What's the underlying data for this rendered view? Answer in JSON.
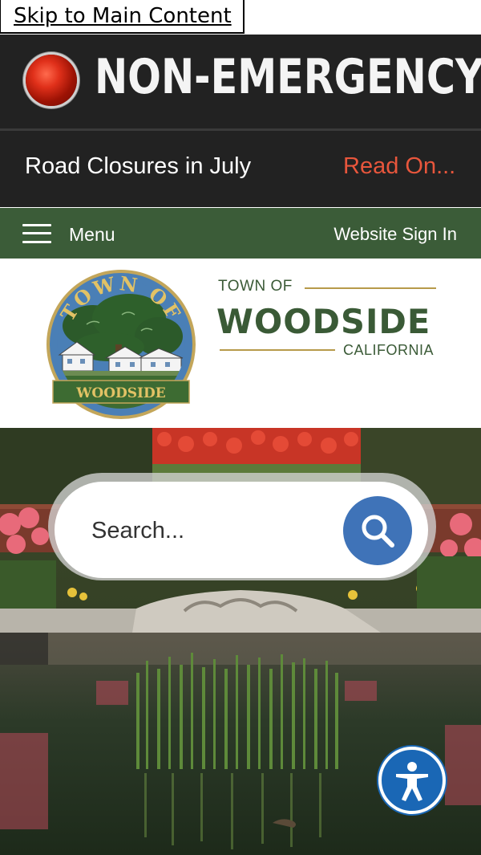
{
  "skip_link": {
    "label": "Skip to Main Content"
  },
  "emergency_banner": {
    "text": "NON-EMERGENCY A",
    "light_color": "#d8301a",
    "icon": "alert-light-icon"
  },
  "alert_ticker": {
    "title": "Road Closures in July",
    "link_label": "Read On...",
    "link_color": "#e8563c"
  },
  "nav": {
    "menu_label": "Menu",
    "sign_in_label": "Website Sign In",
    "bar_color": "#3b5c38",
    "icon": "hamburger-icon"
  },
  "logo": {
    "seal_top": "TOWN OF",
    "seal_bottom": "WOODSIDE",
    "wordmark_top": "TOWN OF",
    "wordmark_main": "WOODSIDE",
    "wordmark_bottom": "CALIFORNIA",
    "brand_green": "#3a5a36",
    "brand_gold": "#b79a4a"
  },
  "search": {
    "placeholder": "Search...",
    "button_color": "#3f73b8",
    "icon": "search-icon"
  },
  "accessibility": {
    "icon": "accessibility-icon",
    "color": "#1a67b5"
  }
}
